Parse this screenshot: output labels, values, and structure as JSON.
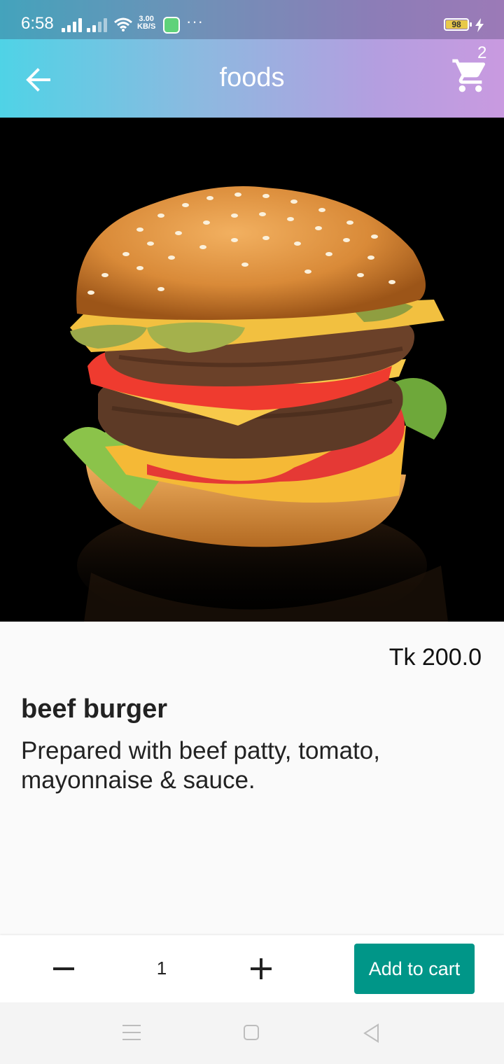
{
  "status_bar": {
    "time": "6:58",
    "net_speed_value": "3.00",
    "net_speed_unit": "KB/S",
    "more": "···",
    "battery_level": "98"
  },
  "app_bar": {
    "title": "foods",
    "cart_count": "2"
  },
  "product": {
    "price": "Tk 200.0",
    "name": "beef burger",
    "description": "Prepared with beef patty, tomato, mayonnaise & sauce."
  },
  "quantity_bar": {
    "quantity": "1",
    "add_to_cart_label": "Add to cart"
  },
  "colors": {
    "accent": "#009688",
    "gradient_start": "#4fd3e6",
    "gradient_end": "#c99ae0"
  }
}
